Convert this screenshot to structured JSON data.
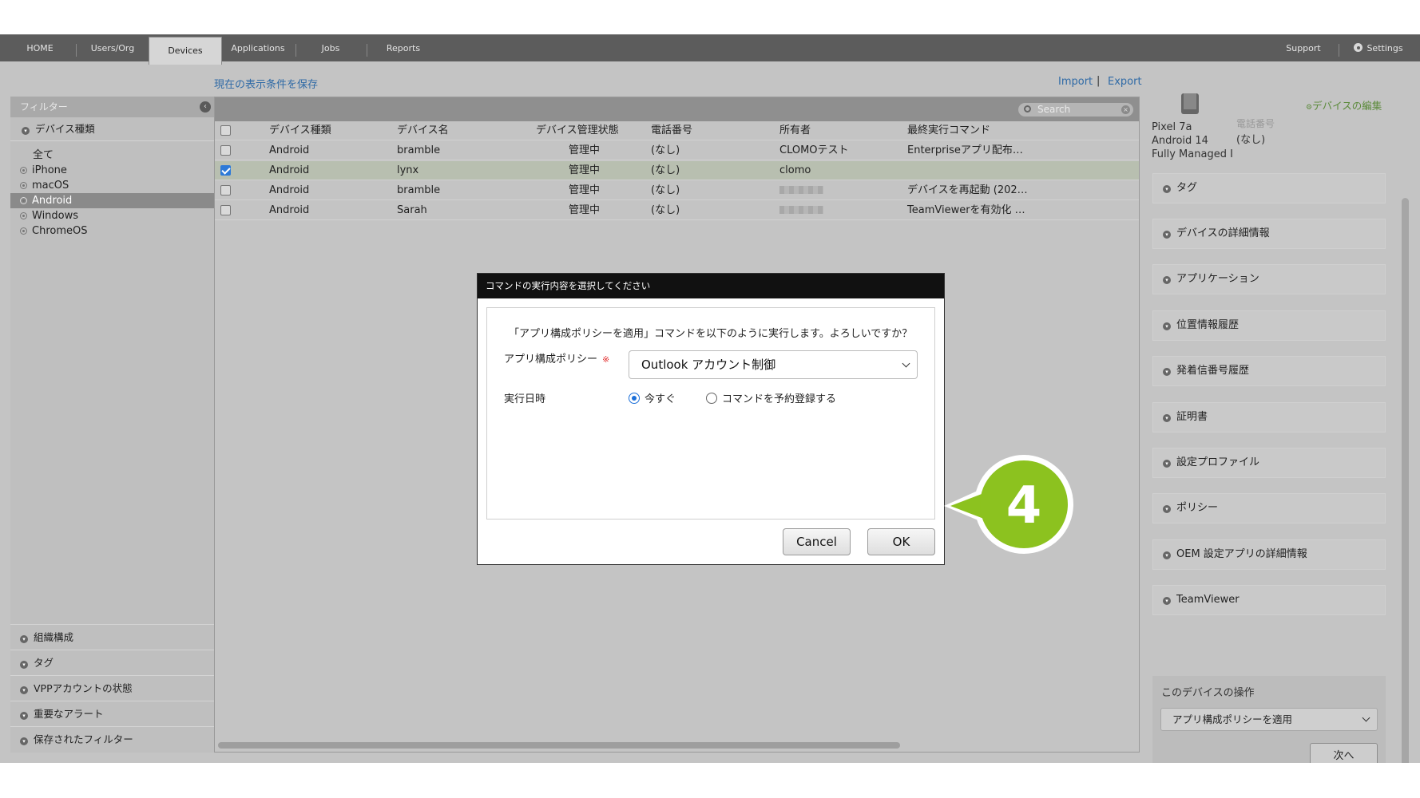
{
  "nav": {
    "tabs": [
      "HOME",
      "Users/Org",
      "Devices",
      "Applications",
      "Jobs",
      "Reports"
    ],
    "active_tab": "Devices",
    "support": "Support",
    "settings": "Settings"
  },
  "subbar": {
    "save_view": "現在の表示条件を保存",
    "import": "Import",
    "separator": "|",
    "export": "Export"
  },
  "sidebar": {
    "filter_title": "フィルター",
    "device_type_header": "デバイス種類",
    "device_types": [
      "全て",
      "iPhone",
      "macOS",
      "Android",
      "Windows",
      "ChromeOS"
    ],
    "active_type": "Android",
    "bottom_sections": [
      "組織構成",
      "タグ",
      "VPPアカウントの状態",
      "重要なアラート",
      "保存されたフィルター"
    ]
  },
  "table": {
    "search_placeholder": "Search",
    "columns": [
      "デバイス種類",
      "デバイス名",
      "デバイス管理状態",
      "電話番号",
      "所有者",
      "最終実行コマンド"
    ],
    "rows": [
      {
        "type": "Android",
        "name": "bramble",
        "status": "管理中",
        "phone": "(なし)",
        "owner": "CLOMOテスト",
        "last_cmd": "Enterpriseアプリ配布…",
        "checked": false,
        "owner_blurred": false
      },
      {
        "type": "Android",
        "name": "lynx",
        "status": "管理中",
        "phone": "(なし)",
        "owner": "clomo",
        "last_cmd": "",
        "checked": true,
        "owner_blurred": false
      },
      {
        "type": "Android",
        "name": "bramble",
        "status": "管理中",
        "phone": "(なし)",
        "owner": "",
        "last_cmd": "デバイスを再起動 (202…",
        "checked": false,
        "owner_blurred": true
      },
      {
        "type": "Android",
        "name": "Sarah",
        "status": "管理中",
        "phone": "(なし)",
        "owner": "",
        "last_cmd": "TeamViewerを有効化 …",
        "checked": false,
        "owner_blurred": true
      }
    ]
  },
  "right_panel": {
    "edit_link": "デバイスの編集",
    "device_model": "Pixel 7a",
    "os_version": "Android 14",
    "mode": "Fully Managed I",
    "phone_label": "電話番号",
    "phone_value": "(なし)",
    "sections": [
      "タグ",
      "デバイスの詳細情報",
      "アプリケーション",
      "位置情報履歴",
      "発着信番号履歴",
      "証明書",
      "設定プロファイル",
      "ポリシー",
      "OEM 設定アプリの詳細情報",
      "TeamViewer"
    ],
    "ops_title": "このデバイスの操作",
    "ops_selected": "アプリ構成ポリシーを適用",
    "next_button": "次へ"
  },
  "dialog": {
    "title": "コマンドの実行内容を選択してください",
    "message": "「アプリ構成ポリシーを適用」コマンドを以下のように実行します。よろしいですか？",
    "policy_label": "アプリ構成ポリシー",
    "required_mark": "※",
    "policy_value": "Outlook アカウント制御",
    "datetime_label": "実行日時",
    "option_now": "今すぐ",
    "option_schedule": "コマンドを予約登録する",
    "selected_option": "now",
    "cancel": "Cancel",
    "ok": "OK"
  },
  "step_badge": "4",
  "colors": {
    "badge_green": "#8cc21f",
    "radio_blue": "#1b6fd9",
    "link_blue": "#2f6aa6",
    "nav_bg": "#5c5c5c"
  }
}
